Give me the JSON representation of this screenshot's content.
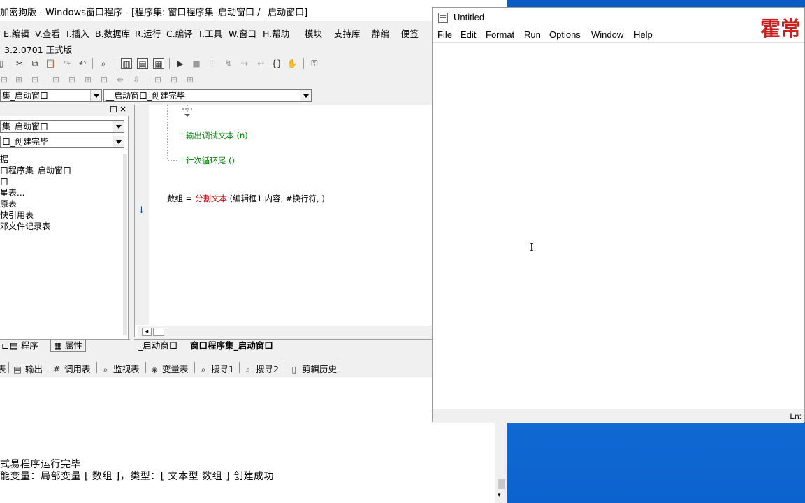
{
  "ide": {
    "title": "加密狗版 - Windows窗口程序 - [程序集: 窗口程序集_启动窗口 / _启动窗口]",
    "menu": [
      "E.编辑",
      "V.查看",
      "I.插入",
      "B.数据库",
      "R.运行",
      "C.编译",
      "T.工具",
      "W.窗口",
      "H.帮助",
      "模块",
      "支持库",
      "静编",
      "便签"
    ],
    "version": "3.2.0701 正式版",
    "combo_left": "集_启动窗口",
    "combo_right": "__启动窗口_创建完毕",
    "panel_combo_1": "集_启动窗口",
    "panel_combo_2": "口_创建完毕",
    "tree": [
      "据",
      "口程序集_启动窗口",
      "口",
      "星表...",
      "原表",
      "快引用表",
      "邓文件记录表"
    ],
    "panel_tabs": [
      "程序",
      "属性"
    ],
    "code": {
      "line1": "' 输出调试文本 (n)",
      "line2": "' 计次循环尾 ()",
      "line3_var": "数组",
      "line3_op": "=",
      "line3_func": "分割文本",
      "line3_args": "(编辑框1.内容, #换行符, )"
    },
    "code_tabs": [
      "_启动窗口",
      "窗口程序集_启动窗口"
    ],
    "bottom_tabs": [
      "输出",
      "调用表",
      "监视表",
      "变量表",
      "搜寻1",
      "搜寻2",
      "剪辑历史"
    ],
    "output": [
      "式易程序运行完毕",
      "能变量：局部变量 [ 数组 ]，类型：[ 文本型 数组 ] 创建成功"
    ]
  },
  "notepad": {
    "title": "Untitled",
    "menu": [
      "File",
      "Edit",
      "Format",
      "Run",
      "Options",
      "Window",
      "Help"
    ],
    "status": "Ln:"
  },
  "watermark": "霍常",
  "colors": {
    "comment": "#008000",
    "keyword": "#c00000",
    "desktop": "#0c63cf",
    "watermark": "#c8201e"
  }
}
